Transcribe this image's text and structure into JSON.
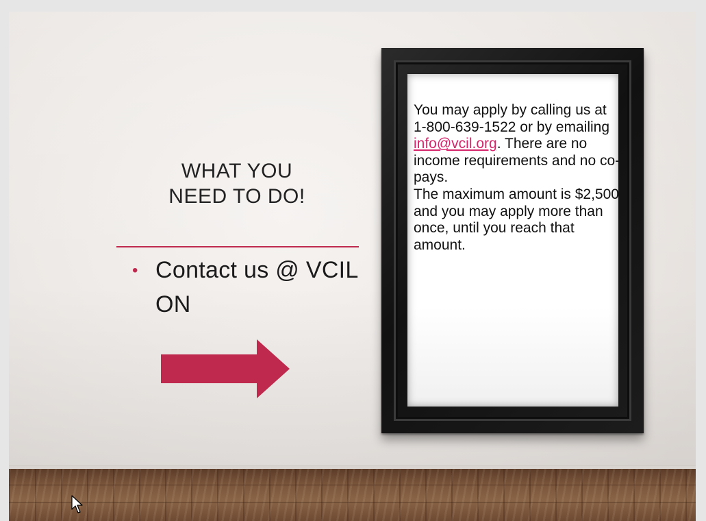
{
  "slide": {
    "title": "WHAT YOU\nNEED TO DO!",
    "bullet": "Contact us @ VCIL ON",
    "accent_color": "#c0294e"
  },
  "frame_text": {
    "part1": "You may apply by calling us at 1-800-639-1522 or by emailing ",
    "email": "info@vcil.org",
    "part2": ". There are no income requirements and no co-pays.",
    "part3": "The maximum amount is $2,500 and you may apply more than once, until you reach that amount.",
    "link_color": "#d6246a"
  },
  "icons": {
    "arrow": "right-arrow-icon",
    "cursor": "mouse-pointer-icon"
  }
}
